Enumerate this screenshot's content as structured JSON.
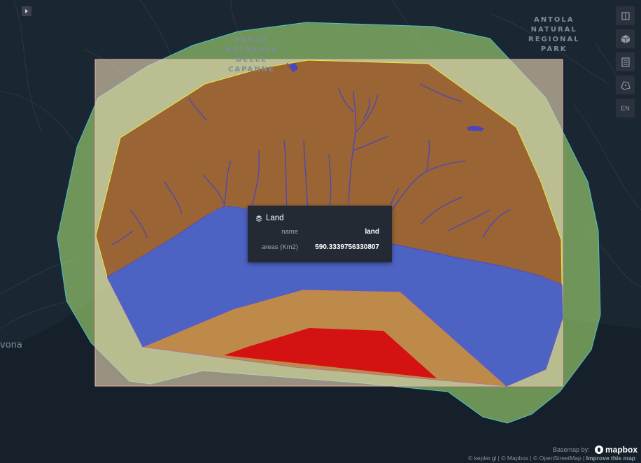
{
  "map": {
    "places": {
      "parco": "PARCO\nNATURALE\nDELLE\nCAPANNE",
      "antola": "ANTOLA\nNATURAL\nREGIONAL\nPARK",
      "city": "vona"
    },
    "colors": {
      "background": "#1b2633",
      "buffer_fill": "#b5f07a",
      "bbox_fill": "#e9d6b3",
      "land_fill": "#9a6434",
      "sea_fill": "#4d63c3",
      "sand_fill": "#bd8a4a",
      "red_fill": "#d41212",
      "river_stroke": "#4b47b8",
      "hull_stroke": "#f2e73a"
    }
  },
  "controls": {
    "side_panel_toggle_icon": "chevron-right-icon",
    "toolbar": [
      {
        "name": "split-map-icon",
        "label": ""
      },
      {
        "name": "3d-map-icon",
        "label": ""
      },
      {
        "name": "legend-icon",
        "label": ""
      },
      {
        "name": "draw-polygon-icon",
        "label": ""
      },
      {
        "name": "locale-button",
        "label": "EN"
      }
    ]
  },
  "tooltip": {
    "layer_icon": "layers-icon",
    "layer_name": "Land",
    "rows": [
      {
        "label": "name",
        "value": "land"
      },
      {
        "label": "areas (Km2)",
        "value": "590.3339756330807"
      }
    ]
  },
  "footer": {
    "basemap_label": "Basemap by:",
    "logo_text": "mapbox",
    "attribution_prefix": "© kepler.gl | © Mapbox | © OpenStreetMap | ",
    "improve_link": "Improve this map"
  }
}
